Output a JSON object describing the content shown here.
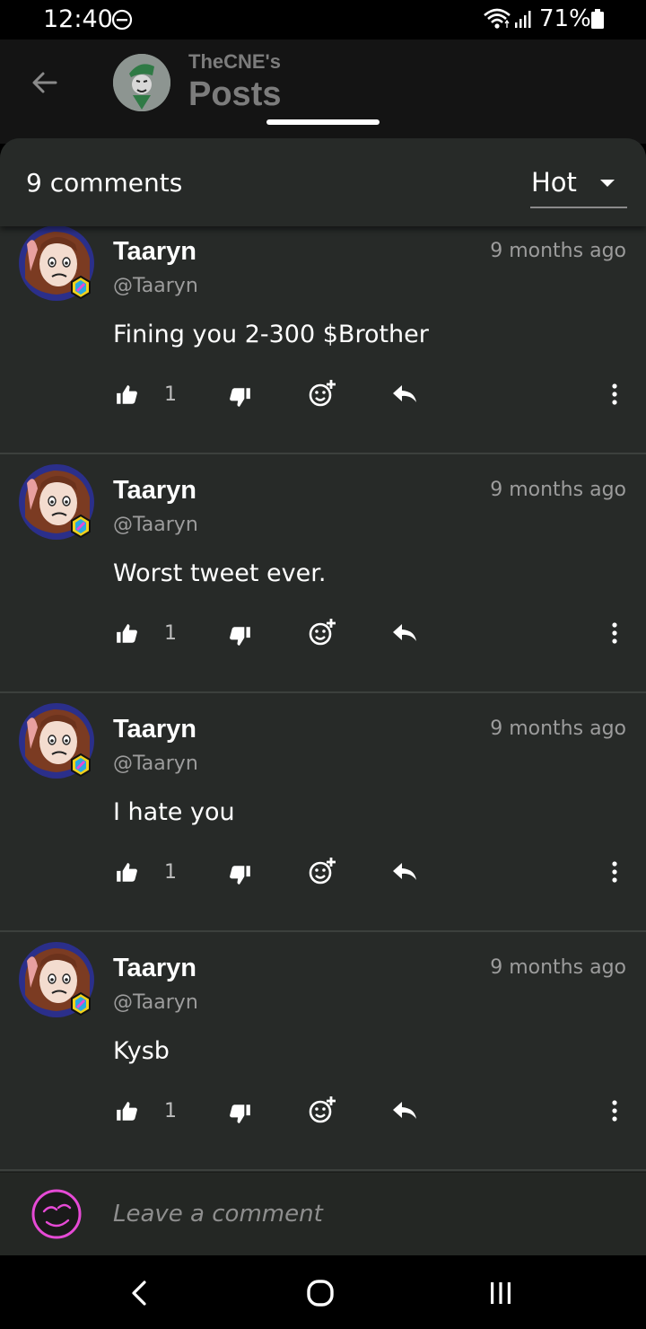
{
  "status_bar": {
    "time": "12:40",
    "battery": "71%"
  },
  "header": {
    "subtitle": "TheCNE's",
    "title": "Posts"
  },
  "comments_panel": {
    "count_label": "9 comments",
    "sort": {
      "selected": "Hot"
    }
  },
  "comments": [
    {
      "author": "Taaryn",
      "handle": "@Taaryn",
      "time": "9 months ago",
      "body": "Fining you 2-300 $Brother",
      "likes": "1"
    },
    {
      "author": "Taaryn",
      "handle": "@Taaryn",
      "time": "9 months ago",
      "body": "Worst tweet ever.",
      "likes": "1"
    },
    {
      "author": "Taaryn",
      "handle": "@Taaryn",
      "time": "9 months ago",
      "body": "I hate you",
      "likes": "1"
    },
    {
      "author": "Taaryn",
      "handle": "@Taaryn",
      "time": "9 months ago",
      "body": "Kysb",
      "likes": "1"
    }
  ],
  "comment_input": {
    "placeholder": "Leave a comment"
  },
  "colors": {
    "panel_bg": "#272a28",
    "accent_avatar": "#e64ad6",
    "badge_yellow": "#f2d21b"
  }
}
